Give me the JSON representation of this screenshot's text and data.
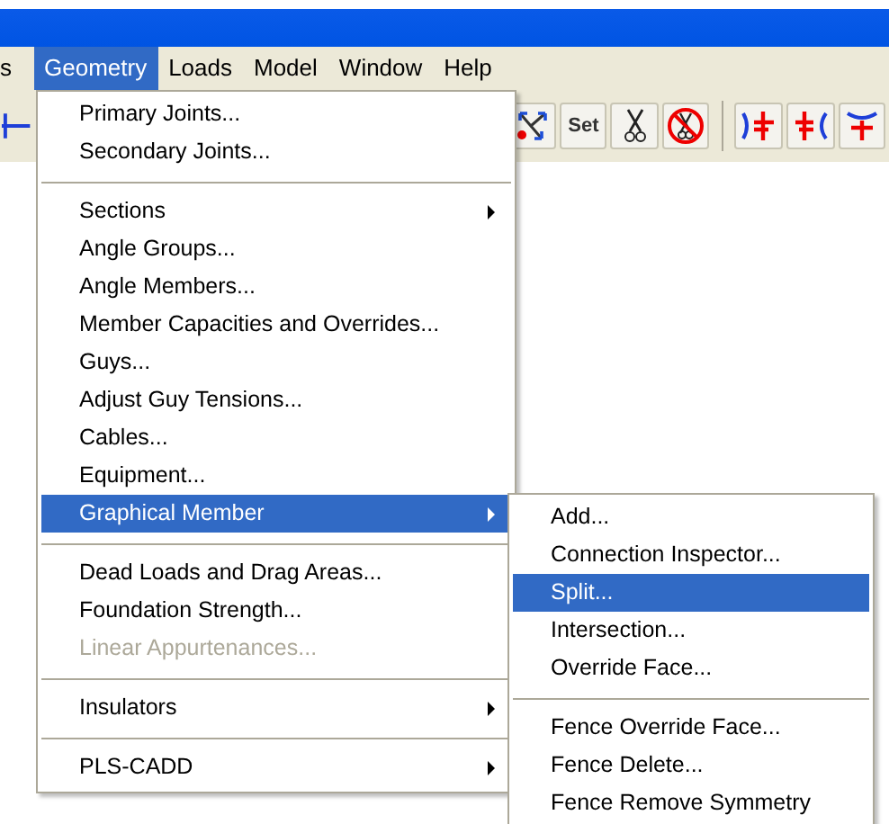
{
  "menu_bar": [
    {
      "label": "s",
      "selected": false
    },
    {
      "label": "Geometry",
      "selected": true
    },
    {
      "label": "Loads",
      "selected": false
    },
    {
      "label": "Model",
      "selected": false
    },
    {
      "label": "Window",
      "selected": false
    },
    {
      "label": "Help",
      "selected": false
    }
  ],
  "toolbar": [
    {
      "kind": "joint"
    },
    {
      "kind": "gap"
    },
    {
      "kind": "branch"
    },
    {
      "kind": "text",
      "label": "Set"
    },
    {
      "kind": "scissors"
    },
    {
      "kind": "no-scissors"
    },
    {
      "kind": "divider"
    },
    {
      "kind": "red-blue-left"
    },
    {
      "kind": "red-blue-right"
    },
    {
      "kind": "red-blue-top"
    }
  ],
  "menu": [
    {
      "kind": "item",
      "label": "Primary Joints...",
      "submenu": false,
      "disabled": false,
      "selected": false
    },
    {
      "kind": "item",
      "label": "Secondary Joints...",
      "submenu": false,
      "disabled": false,
      "selected": false
    },
    {
      "kind": "separator"
    },
    {
      "kind": "item",
      "label": "Sections",
      "submenu": true,
      "disabled": false,
      "selected": false
    },
    {
      "kind": "item",
      "label": "Angle Groups...",
      "submenu": false,
      "disabled": false,
      "selected": false
    },
    {
      "kind": "item",
      "label": "Angle Members...",
      "submenu": false,
      "disabled": false,
      "selected": false
    },
    {
      "kind": "item",
      "label": "Member Capacities and Overrides...",
      "submenu": false,
      "disabled": false,
      "selected": false
    },
    {
      "kind": "item",
      "label": "Guys...",
      "submenu": false,
      "disabled": false,
      "selected": false
    },
    {
      "kind": "item",
      "label": "Adjust Guy Tensions...",
      "submenu": false,
      "disabled": false,
      "selected": false
    },
    {
      "kind": "item",
      "label": "Cables...",
      "submenu": false,
      "disabled": false,
      "selected": false
    },
    {
      "kind": "item",
      "label": "Equipment...",
      "submenu": false,
      "disabled": false,
      "selected": false
    },
    {
      "kind": "item",
      "label": "Graphical Member",
      "submenu": true,
      "disabled": false,
      "selected": true
    },
    {
      "kind": "separator"
    },
    {
      "kind": "item",
      "label": "Dead Loads and Drag Areas...",
      "submenu": false,
      "disabled": false,
      "selected": false
    },
    {
      "kind": "item",
      "label": "Foundation Strength...",
      "submenu": false,
      "disabled": false,
      "selected": false
    },
    {
      "kind": "item",
      "label": "Linear Appurtenances...",
      "submenu": false,
      "disabled": true,
      "selected": false
    },
    {
      "kind": "separator"
    },
    {
      "kind": "item",
      "label": "Insulators",
      "submenu": true,
      "disabled": false,
      "selected": false
    },
    {
      "kind": "separator"
    },
    {
      "kind": "item",
      "label": "PLS-CADD",
      "submenu": true,
      "disabled": false,
      "selected": false
    }
  ],
  "submenu": [
    {
      "kind": "item",
      "label": "Add...",
      "submenu": false,
      "disabled": false,
      "selected": false
    },
    {
      "kind": "item",
      "label": "Connection Inspector...",
      "submenu": false,
      "disabled": false,
      "selected": false
    },
    {
      "kind": "item",
      "label": "Split...",
      "submenu": false,
      "disabled": false,
      "selected": true
    },
    {
      "kind": "item",
      "label": "Intersection...",
      "submenu": false,
      "disabled": false,
      "selected": false
    },
    {
      "kind": "item",
      "label": "Override Face...",
      "submenu": false,
      "disabled": false,
      "selected": false
    },
    {
      "kind": "separator"
    },
    {
      "kind": "item",
      "label": "Fence Override Face...",
      "submenu": false,
      "disabled": false,
      "selected": false
    },
    {
      "kind": "item",
      "label": "Fence Delete...",
      "submenu": false,
      "disabled": false,
      "selected": false
    },
    {
      "kind": "item",
      "label": "Fence Remove Symmetry",
      "submenu": false,
      "disabled": false,
      "selected": false
    }
  ]
}
